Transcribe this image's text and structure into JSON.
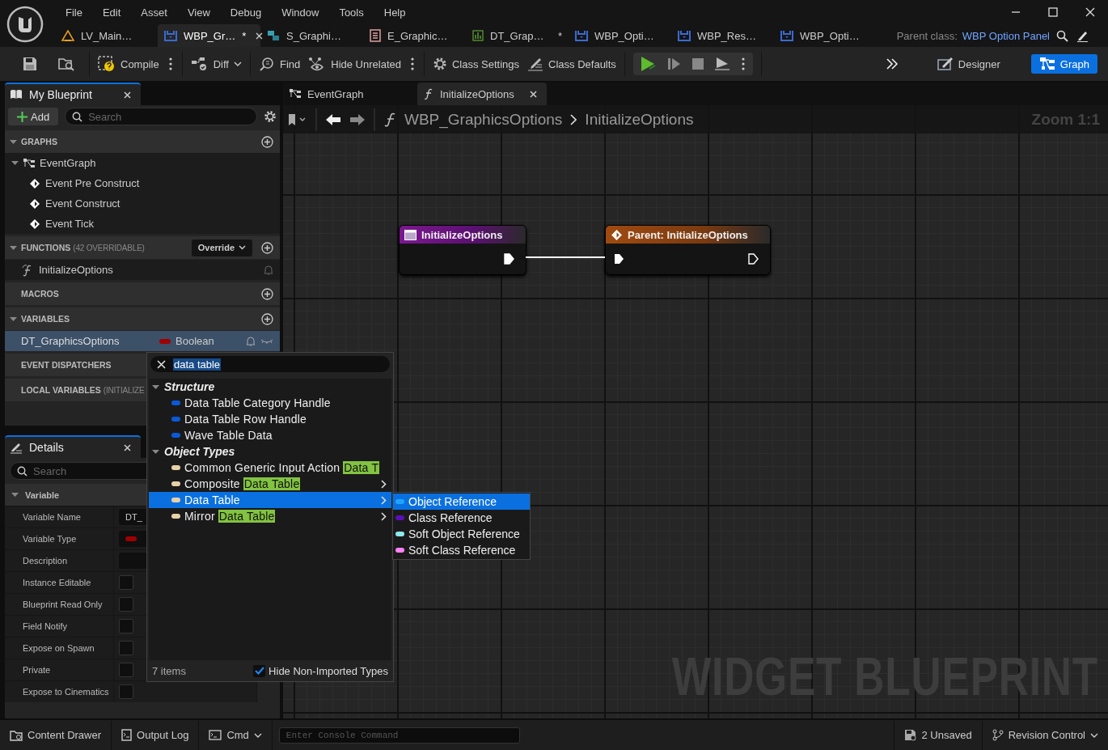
{
  "menu": [
    "File",
    "Edit",
    "Asset",
    "View",
    "Debug",
    "Window",
    "Tools",
    "Help"
  ],
  "doc_tabs": [
    {
      "kind": "level",
      "label": "LV_Main…",
      "selected": false
    },
    {
      "kind": "widget",
      "label": "WBP_Gr…",
      "modified_mark": "*",
      "selected": true
    },
    {
      "kind": "struct",
      "label": "S_Graphi…",
      "selected": false
    },
    {
      "kind": "enum",
      "label": "E_Graphic…",
      "selected": false
    },
    {
      "kind": "datatable",
      "label": "DT_Grap…",
      "modified_mark": "*",
      "selected": false
    },
    {
      "kind": "widget",
      "label": "WBP_Opti…",
      "selected": false
    },
    {
      "kind": "widget",
      "label": "WBP_Res…",
      "selected": false
    },
    {
      "kind": "widget",
      "label": "WBP_Opti…",
      "selected": false
    }
  ],
  "parent_class": {
    "label": "Parent class:",
    "value": "WBP Option Panel"
  },
  "toolbar": [
    [
      {
        "kind": "save"
      },
      {
        "kind": "browse"
      }
    ],
    [
      {
        "kind": "compile",
        "label": "Compile"
      },
      {
        "kind": "more"
      }
    ],
    [
      {
        "kind": "diff",
        "label": "Diff"
      }
    ],
    [
      {
        "kind": "find",
        "label": "Find"
      },
      {
        "kind": "hide",
        "label": "Hide Unrelated"
      },
      {
        "kind": "more"
      }
    ],
    [
      {
        "kind": "settings",
        "label": "Class Settings"
      },
      {
        "kind": "defaults",
        "label": "Class Defaults"
      }
    ]
  ],
  "play_group": [
    {
      "kind": "play"
    },
    {
      "kind": "step"
    },
    {
      "kind": "stop"
    },
    {
      "kind": "eject"
    }
  ],
  "modes": [
    {
      "kind": "designer",
      "label": "Designer",
      "selected": false
    },
    {
      "kind": "graph",
      "label": "Graph",
      "selected": true
    }
  ],
  "my_blueprint": {
    "title": "My Blueprint",
    "add_label": "Add",
    "search_placeholder": "Search",
    "sections": [
      {
        "title": "GRAPHS",
        "expanded": true,
        "add": true,
        "items": [
          {
            "kind": "graph",
            "label": "EventGraph",
            "expanded": true,
            "children": [
              {
                "kind": "event",
                "label": "Event Pre Construct"
              },
              {
                "kind": "event",
                "label": "Event Construct"
              },
              {
                "kind": "event",
                "label": "Event Tick"
              }
            ]
          }
        ]
      },
      {
        "title": "FUNCTIONS",
        "note": "(42 OVERRIDABLE)",
        "expanded": true,
        "add": true,
        "override_label": "Override",
        "items": [
          {
            "kind": "function",
            "label": "InitializeOptions"
          }
        ]
      },
      {
        "title": "MACROS",
        "add": true
      },
      {
        "title": "VARIABLES",
        "expanded": true,
        "add": true,
        "items": [
          {
            "kind": "variable",
            "label": "DT_GraphicsOptions",
            "type": "Boolean",
            "color": "#a00000",
            "selected": true
          }
        ]
      },
      {
        "title": "EVENT DISPATCHERS"
      },
      {
        "title": "LOCAL VARIABLES",
        "note": "(INITIALIZE"
      }
    ]
  },
  "details": {
    "title": "Details",
    "search_placeholder": "Search",
    "category": "Variable",
    "category_expanded": true,
    "rows": [
      {
        "kind": "text",
        "label": "Variable Name",
        "value": "DT_"
      },
      {
        "kind": "type",
        "label": "Variable Type",
        "color": "#a00000"
      },
      {
        "kind": "text",
        "label": "Description"
      },
      {
        "kind": "check",
        "label": "Instance Editable",
        "checked": false
      },
      {
        "kind": "check",
        "label": "Blueprint Read Only",
        "checked": false
      },
      {
        "kind": "check",
        "label": "Field Notify",
        "checked": false
      },
      {
        "kind": "check",
        "label": "Expose on Spawn",
        "checked": false
      },
      {
        "kind": "check",
        "label": "Private",
        "checked": false
      },
      {
        "kind": "check",
        "label": "Expose to Cinematics",
        "checked": false
      }
    ]
  },
  "graph": {
    "tabs": [
      {
        "kind": "graph",
        "label": "EventGraph",
        "selected": false
      },
      {
        "kind": "function",
        "label": "InitializeOptions",
        "selected": true
      }
    ],
    "breadcrumb": [
      "WBP_GraphicsOptions",
      "InitializeOptions"
    ],
    "zoom": "Zoom 1:1",
    "watermark": "WIDGET BLUEPRINT",
    "nodes": [
      {
        "kind": "entry",
        "title": "InitializeOptions",
        "exec_in": false,
        "exec_out_connected": true
      },
      {
        "kind": "parent",
        "title": "Parent: InitializeOptions",
        "exec_in": true,
        "exec_out_connected": false
      }
    ]
  },
  "type_picker": {
    "query": "data table",
    "categories": [
      {
        "title": "Structure",
        "expanded": true,
        "items": [
          {
            "color": "#0a5ad8",
            "prefix": "Data Table Category Handle",
            "has_submenu": false,
            "selected": false
          },
          {
            "color": "#0a5ad8",
            "prefix": "Data Table Row Handle",
            "has_submenu": false,
            "selected": false
          },
          {
            "color": "#0a5ad8",
            "prefix": "Wave Table Data",
            "has_submenu": false,
            "selected": false
          }
        ]
      },
      {
        "title": "Object Types",
        "expanded": true,
        "items": [
          {
            "color": "#e8d0a8",
            "prefix": "Common Generic Input Action",
            "match": "Data T",
            "has_submenu": false,
            "selected": false
          },
          {
            "color": "#e8d0a8",
            "prefix": "Composite",
            "match": "Data Table",
            "has_submenu": true,
            "selected": false
          },
          {
            "color": "#e8d0a8",
            "prefix": "Data Table",
            "has_submenu": true,
            "selected": true
          },
          {
            "color": "#e8d0a8",
            "prefix": "Mirror",
            "match": "Data Table",
            "has_submenu": true,
            "selected": false
          }
        ]
      }
    ],
    "count": "7 items",
    "hide_label": "Hide Non-Imported Types",
    "hide_checked": true,
    "submenu": [
      {
        "label": "Object Reference",
        "color": "#1ea4ff",
        "selected": true
      },
      {
        "label": "Class Reference",
        "color": "#5a10b8",
        "selected": false
      },
      {
        "label": "Soft Object Reference",
        "color": "#8ee8ec",
        "selected": false
      },
      {
        "label": "Soft Class Reference",
        "color": "#ff82f4",
        "selected": false
      }
    ]
  },
  "status_bar": {
    "left": [
      {
        "kind": "drawer",
        "label": "Content Drawer"
      },
      {
        "kind": "log",
        "label": "Output Log"
      }
    ],
    "cmd": {
      "label": "Cmd",
      "placeholder": "Enter Console Command"
    },
    "right": [
      {
        "kind": "unsaved",
        "label": "2 Unsaved"
      },
      {
        "kind": "revision",
        "label": "Revision Control"
      }
    ]
  }
}
